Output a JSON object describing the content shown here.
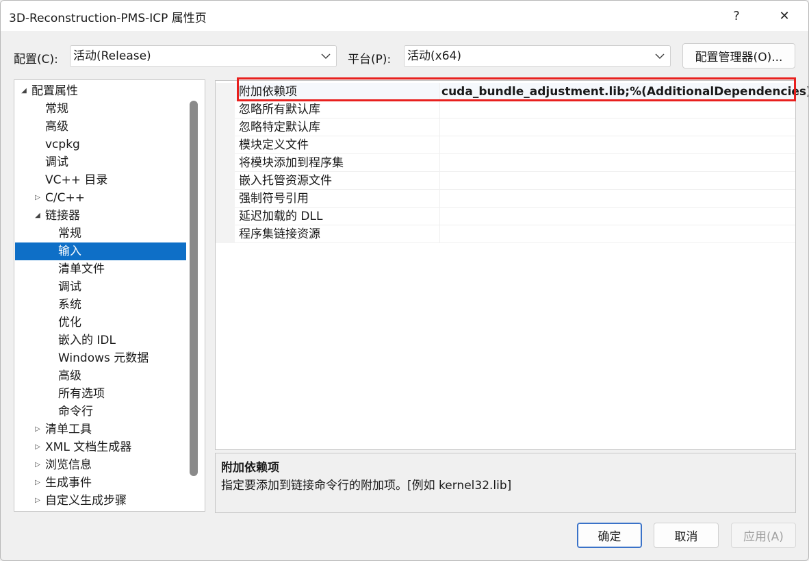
{
  "window": {
    "title": "3D-Reconstruction-PMS-ICP 属性页",
    "help": "?",
    "close": "✕"
  },
  "toolbar": {
    "config_label": "配置(C):",
    "config_value": "活动(Release)",
    "platform_label": "平台(P):",
    "platform_value": "活动(x64)",
    "config_manager": "配置管理器(O)..."
  },
  "icons": {
    "expanded": "◢",
    "collapsed": "▷",
    "chevron": "⌄"
  },
  "tree": [
    {
      "label": "配置属性",
      "expander": "expanded",
      "level": 0
    },
    {
      "label": "常规",
      "expander": "",
      "level": 1
    },
    {
      "label": "高级",
      "expander": "",
      "level": 1
    },
    {
      "label": "vcpkg",
      "expander": "",
      "level": 1
    },
    {
      "label": "调试",
      "expander": "",
      "level": 1
    },
    {
      "label": "VC++ 目录",
      "expander": "",
      "level": 1
    },
    {
      "label": "C/C++",
      "expander": "collapsed",
      "level": 1
    },
    {
      "label": "链接器",
      "expander": "expanded",
      "level": 1
    },
    {
      "label": "常规",
      "expander": "",
      "level": 2
    },
    {
      "label": "输入",
      "expander": "",
      "level": 2,
      "selected": true
    },
    {
      "label": "清单文件",
      "expander": "",
      "level": 2
    },
    {
      "label": "调试",
      "expander": "",
      "level": 2
    },
    {
      "label": "系统",
      "expander": "",
      "level": 2
    },
    {
      "label": "优化",
      "expander": "",
      "level": 2
    },
    {
      "label": "嵌入的 IDL",
      "expander": "",
      "level": 2
    },
    {
      "label": "Windows 元数据",
      "expander": "",
      "level": 2
    },
    {
      "label": "高级",
      "expander": "",
      "level": 2
    },
    {
      "label": "所有选项",
      "expander": "",
      "level": 2
    },
    {
      "label": "命令行",
      "expander": "",
      "level": 2
    },
    {
      "label": "清单工具",
      "expander": "collapsed",
      "level": 1
    },
    {
      "label": "XML 文档生成器",
      "expander": "collapsed",
      "level": 1
    },
    {
      "label": "浏览信息",
      "expander": "collapsed",
      "level": 1
    },
    {
      "label": "生成事件",
      "expander": "collapsed",
      "level": 1
    },
    {
      "label": "自定义生成步骤",
      "expander": "collapsed",
      "level": 1
    }
  ],
  "properties": [
    {
      "name": "附加依赖项",
      "value": "cuda_bundle_adjustment.lib;%(AdditionalDependencies)"
    },
    {
      "name": "忽略所有默认库",
      "value": ""
    },
    {
      "name": "忽略特定默认库",
      "value": ""
    },
    {
      "name": "模块定义文件",
      "value": ""
    },
    {
      "name": "将模块添加到程序集",
      "value": ""
    },
    {
      "name": "嵌入托管资源文件",
      "value": ""
    },
    {
      "name": "强制符号引用",
      "value": ""
    },
    {
      "name": "延迟加载的 DLL",
      "value": ""
    },
    {
      "name": "程序集链接资源",
      "value": ""
    }
  ],
  "description": {
    "title": "附加依赖项",
    "text": "指定要添加到链接命令行的附加项。[例如 kernel32.lib]"
  },
  "buttons": {
    "ok": "确定",
    "cancel": "取消",
    "apply": "应用(A)"
  }
}
